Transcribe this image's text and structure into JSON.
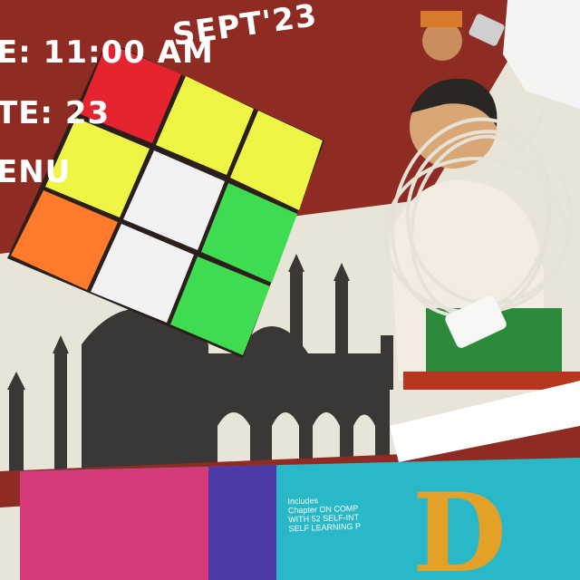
{
  "poster": {
    "time_line": "E: 11:00 AM",
    "date_line": "TE: 23",
    "month_line": "SEPT'23",
    "venue_line": "ENU"
  },
  "book": {
    "lines": [
      "Includes",
      "Chapter ON COMP",
      "WITH 52 SELF-INT",
      "SELF LEARNING P"
    ],
    "title_fragment": "D"
  },
  "colors": {
    "poster_red": "#8e2b22",
    "cube_red": "#e5242f",
    "cube_yellow": "#eef545",
    "cube_white": "#f2f2f4",
    "cube_green": "#3fdc52",
    "cube_orange": "#ff7a2a",
    "book_pink": "#d63a7a",
    "book_teal": "#29b8c8"
  }
}
